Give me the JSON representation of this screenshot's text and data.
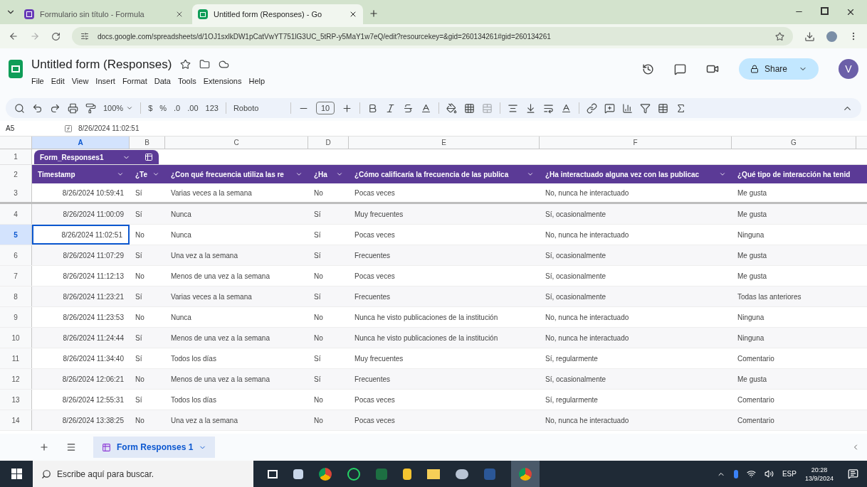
{
  "browser": {
    "tabs": [
      {
        "title": "Formulario sin título - Formula",
        "selected": false,
        "kind": "forms"
      },
      {
        "title": "Untitled form (Responses) - Go",
        "selected": true,
        "kind": "sheets"
      }
    ],
    "url": "docs.google.com/spreadsheets/d/1OJ1sxlkDW1pCatVwYT751lG3UC_5tRP-y5MaY1w7eQ/edit?resourcekey=&gid=260134261#gid=260134261"
  },
  "document": {
    "title": "Untitled form (Responses)",
    "menu": [
      "File",
      "Edit",
      "View",
      "Insert",
      "Format",
      "Data",
      "Tools",
      "Extensions",
      "Help"
    ],
    "share": "Share",
    "avatar": "V"
  },
  "toolbar": {
    "zoom": "100%",
    "currency": "$",
    "percent": "%",
    "decrease_decimals": ".0",
    "increase_decimals": ".00",
    "number_format": "123",
    "font": "Roboto",
    "font_size": "10"
  },
  "formula_bar": {
    "cell": "A5",
    "value": "8/26/2024 11:02:51"
  },
  "table": {
    "name_row_number": "1",
    "header_row_number": "2",
    "name": "Form_Responses1",
    "columns": [
      {
        "letter": "A",
        "header": "Timestamp",
        "selected": true
      },
      {
        "letter": "B",
        "header": "¿Te",
        "selected": false
      },
      {
        "letter": "C",
        "header": "¿Con qué frecuencia utiliza las re",
        "selected": false
      },
      {
        "letter": "D",
        "header": "¿Ha",
        "selected": false
      },
      {
        "letter": "E",
        "header": "¿Cómo calificaría la frecuencia de las publica",
        "selected": false
      },
      {
        "letter": "F",
        "header": "¿Ha interactuado alguna vez con las publicac",
        "selected": false
      },
      {
        "letter": "G",
        "header": "¿Qué tipo de interacción ha tenid",
        "selected": false
      }
    ],
    "rows": [
      {
        "number": "3",
        "selected": false,
        "cells": [
          "8/26/2024 10:59:41",
          "Sí",
          "Varias veces a la semana",
          "No",
          "Pocas veces",
          "No, nunca he interactuado",
          "Me gusta"
        ]
      },
      {
        "number": "4",
        "selected": false,
        "cells": [
          "8/26/2024 11:00:09",
          "Sí",
          "Nunca",
          "Sí",
          "Muy frecuentes",
          "Sí, ocasionalmente",
          "Me gusta"
        ]
      },
      {
        "number": "5",
        "selected": true,
        "cells": [
          "8/26/2024 11:02:51",
          "No",
          "Nunca",
          "Sí",
          "Pocas veces",
          "No, nunca he interactuado",
          "Ninguna"
        ]
      },
      {
        "number": "6",
        "selected": false,
        "cells": [
          "8/26/2024 11:07:29",
          "Sí",
          "Una vez a la semana",
          "Sí",
          "Frecuentes",
          "Sí, ocasionalmente",
          "Me gusta"
        ]
      },
      {
        "number": "7",
        "selected": false,
        "cells": [
          "8/26/2024 11:12:13",
          "No",
          "Menos de una vez a la semana",
          "No",
          "Pocas veces",
          "Sí, ocasionalmente",
          "Me gusta"
        ]
      },
      {
        "number": "8",
        "selected": false,
        "cells": [
          "8/26/2024 11:23:21",
          "Sí",
          "Varias veces a la semana",
          "Sí",
          "Frecuentes",
          "Sí, ocasionalmente",
          "Todas las anteriores"
        ]
      },
      {
        "number": "9",
        "selected": false,
        "cells": [
          "8/26/2024 11:23:53",
          "No",
          "Nunca",
          "No",
          "Nunca he visto publicaciones de la institución",
          "No, nunca he interactuado",
          "Ninguna"
        ]
      },
      {
        "number": "10",
        "selected": false,
        "cells": [
          "8/26/2024 11:24:44",
          "Sí",
          "Menos de una vez a la semana",
          "No",
          "Nunca he visto publicaciones de la institución",
          "No, nunca he interactuado",
          "Ninguna"
        ]
      },
      {
        "number": "11",
        "selected": false,
        "cells": [
          "8/26/2024 11:34:40",
          "Sí",
          "Todos los días",
          "Sí",
          "Muy frecuentes",
          "Sí, regularmente",
          "Comentario"
        ]
      },
      {
        "number": "12",
        "selected": false,
        "cells": [
          "8/26/2024 12:06:21",
          "No",
          "Menos de una vez a la semana",
          "Sí",
          "Frecuentes",
          "Sí, ocasionalmente",
          "Me gusta"
        ]
      },
      {
        "number": "13",
        "selected": false,
        "cells": [
          "8/26/2024 12:55:31",
          "Sí",
          "Todos los días",
          "No",
          "Pocas veces",
          "Sí, regularmente",
          "Comentario"
        ]
      },
      {
        "number": "14",
        "selected": false,
        "cells": [
          "8/26/2024 13:38:25",
          "No",
          "Una vez a la semana",
          "No",
          "Pocas veces",
          "No, nunca he interactuado",
          "Comentario"
        ]
      }
    ]
  },
  "sheet_tabs": [
    {
      "label": "Form Responses 1",
      "selected": true
    }
  ],
  "taskbar": {
    "search_placeholder": "Escribe aquí para buscar.",
    "language": "ESP",
    "time": "20:28",
    "date": "13/9/2024"
  }
}
